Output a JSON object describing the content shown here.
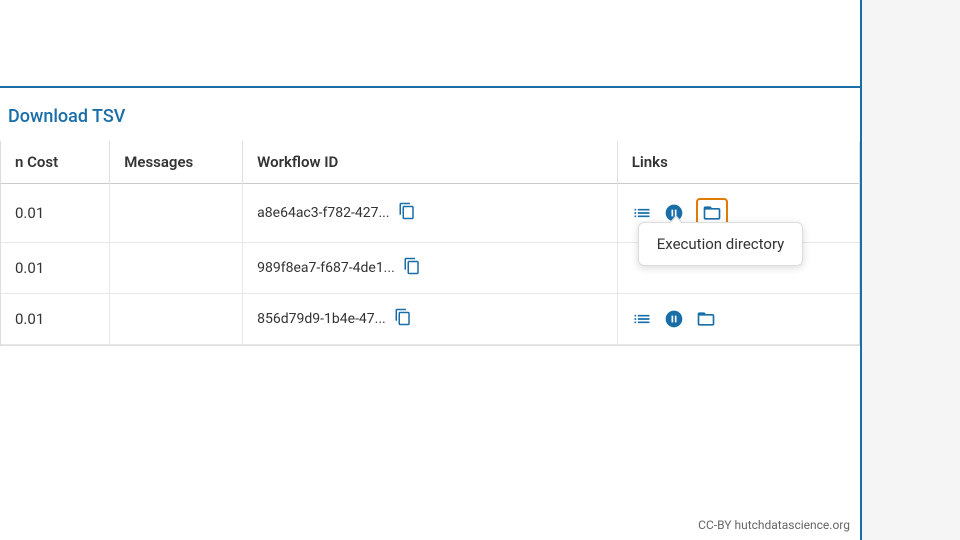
{
  "page": {
    "download_label": "Download TSV",
    "table": {
      "headers": [
        {
          "key": "cost",
          "label": "n Cost"
        },
        {
          "key": "messages",
          "label": "Messages"
        },
        {
          "key": "workflow_id",
          "label": "Workflow ID"
        },
        {
          "key": "links",
          "label": "Links"
        }
      ],
      "rows": [
        {
          "cost": "0.01",
          "messages": "",
          "workflow_id": "a8e64ac3-f782-427...",
          "has_tooltip": true,
          "tooltip_text": "Execution directory"
        },
        {
          "cost": "0.01",
          "messages": "",
          "workflow_id": "989f8ea7-f687-4de1...",
          "has_tooltip": false,
          "tooltip_text": ""
        },
        {
          "cost": "0.01",
          "messages": "",
          "workflow_id": "856d79d9-1b4e-47...",
          "has_tooltip": false,
          "tooltip_text": ""
        }
      ]
    },
    "footer": {
      "license": "CC-BY",
      "site": "hutchdatascience.org"
    }
  }
}
